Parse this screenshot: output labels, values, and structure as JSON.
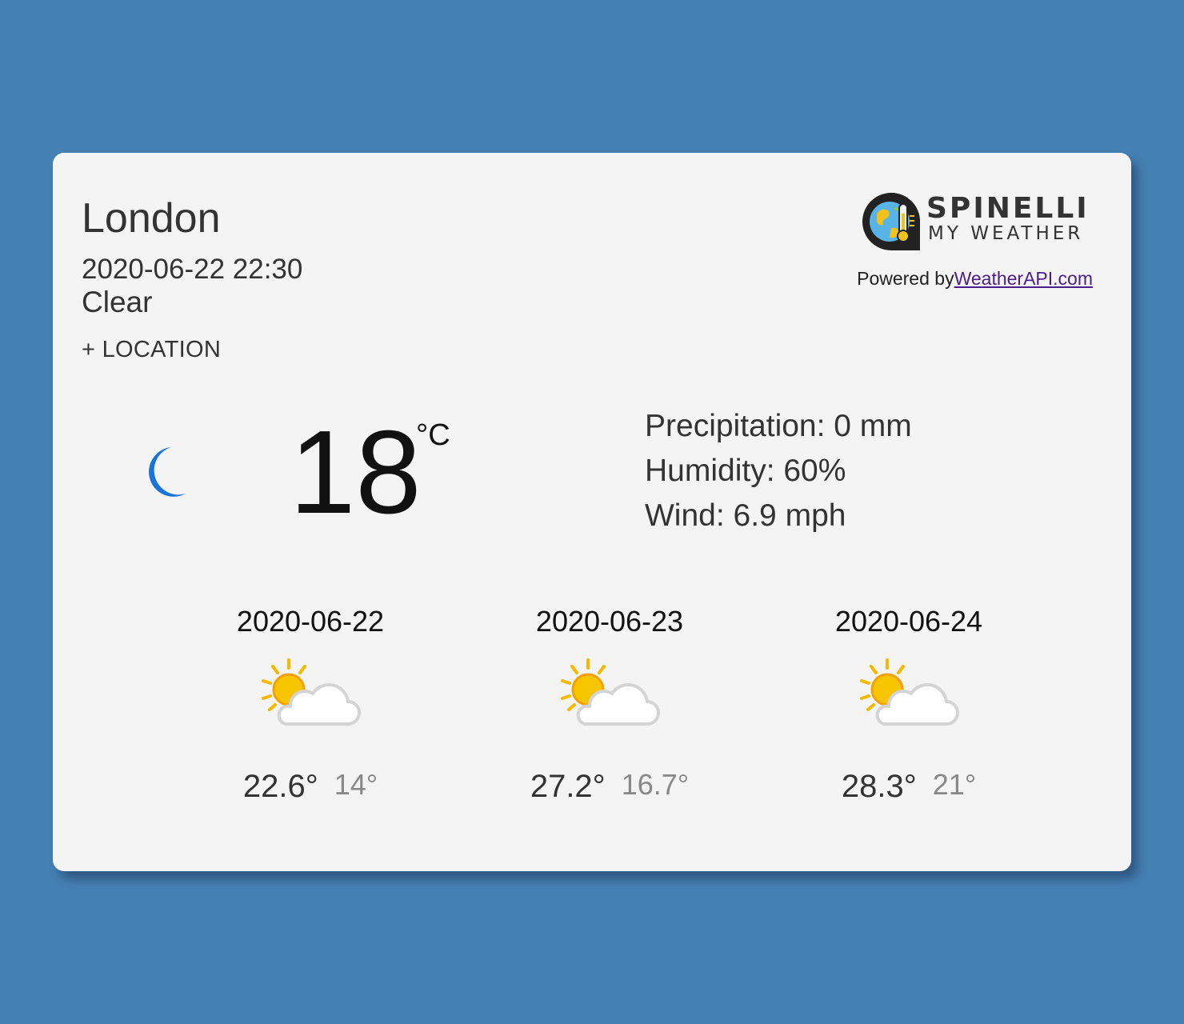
{
  "location": {
    "city": "London",
    "datetime": "2020-06-22 22:30",
    "condition": "Clear",
    "add_location_label": "+ LOCATION"
  },
  "branding": {
    "logo_title": "SPINELLI",
    "logo_subtitle": "MY WEATHER",
    "powered_by": "Powered by",
    "provider_link": "WeatherAPI.com"
  },
  "current": {
    "icon": "moon-icon",
    "temperature": "18",
    "unit": "°C",
    "precipitation": "Precipitation: 0 mm",
    "humidity": "Humidity: 60%",
    "wind": "Wind: 6.9 mph"
  },
  "forecast": [
    {
      "date": "2020-06-22",
      "icon": "partly-cloudy-icon",
      "high": "22.6°",
      "low": "14°"
    },
    {
      "date": "2020-06-23",
      "icon": "partly-cloudy-icon",
      "high": "27.2°",
      "low": "16.7°"
    },
    {
      "date": "2020-06-24",
      "icon": "partly-cloudy-icon",
      "high": "28.3°",
      "low": "21°"
    }
  ],
  "colors": {
    "background": "#4580b3",
    "card": "#f4f4f4",
    "moon": "#1a73d9",
    "sun": "#f7c600",
    "link": "#4b1e8c"
  }
}
